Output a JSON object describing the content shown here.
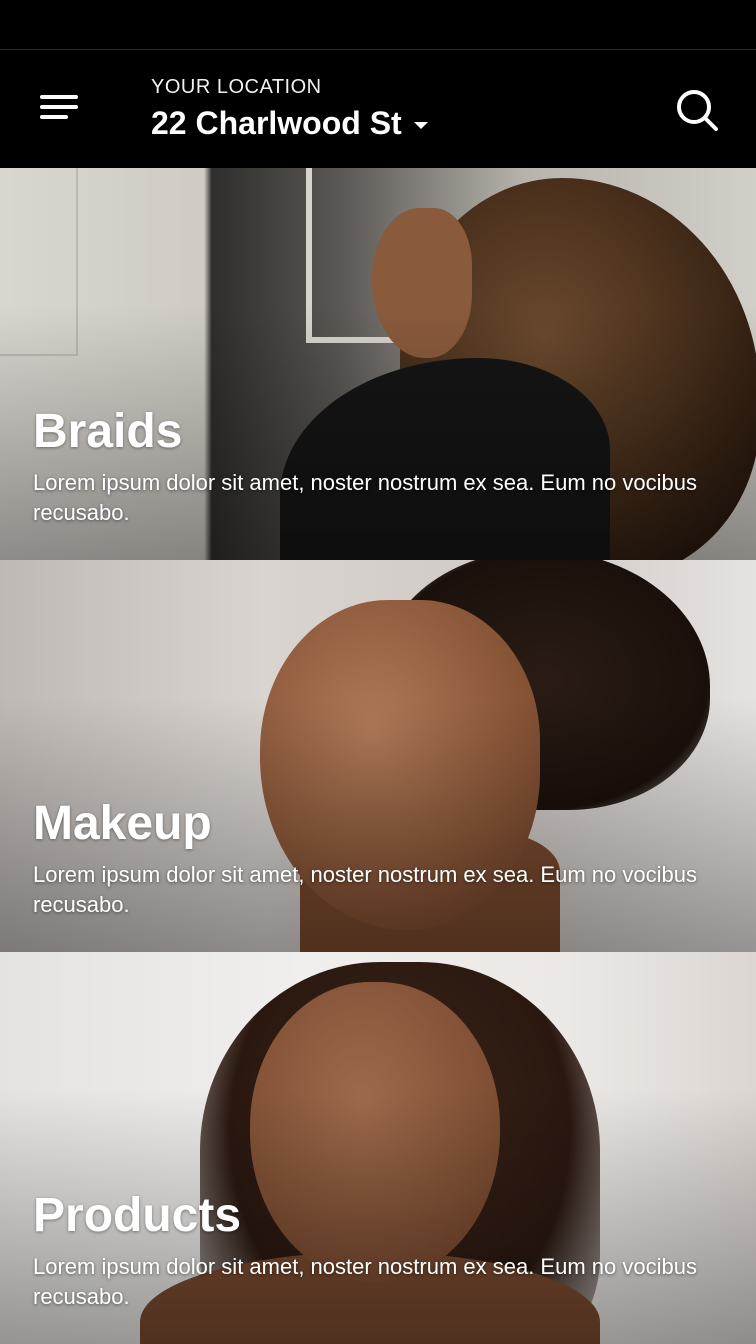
{
  "header": {
    "location_label": "YOUR LOCATION",
    "location_value": "22 Charlwood St"
  },
  "categories": [
    {
      "title": "Braids",
      "description": "Lorem ipsum dolor sit amet, noster nostrum ex sea. Eum no vocibus recusabo."
    },
    {
      "title": "Makeup",
      "description": "Lorem ipsum dolor sit amet, noster nostrum ex sea. Eum no vocibus recusabo."
    },
    {
      "title": "Products",
      "description": "Lorem ipsum dolor sit amet, noster nostrum ex sea. Eum no vocibus recusabo."
    }
  ],
  "icons": {
    "menu": "menu-icon",
    "dropdown": "chevron-down-icon",
    "search": "search-icon"
  },
  "colors": {
    "header_bg": "#000000",
    "text": "#ffffff"
  }
}
